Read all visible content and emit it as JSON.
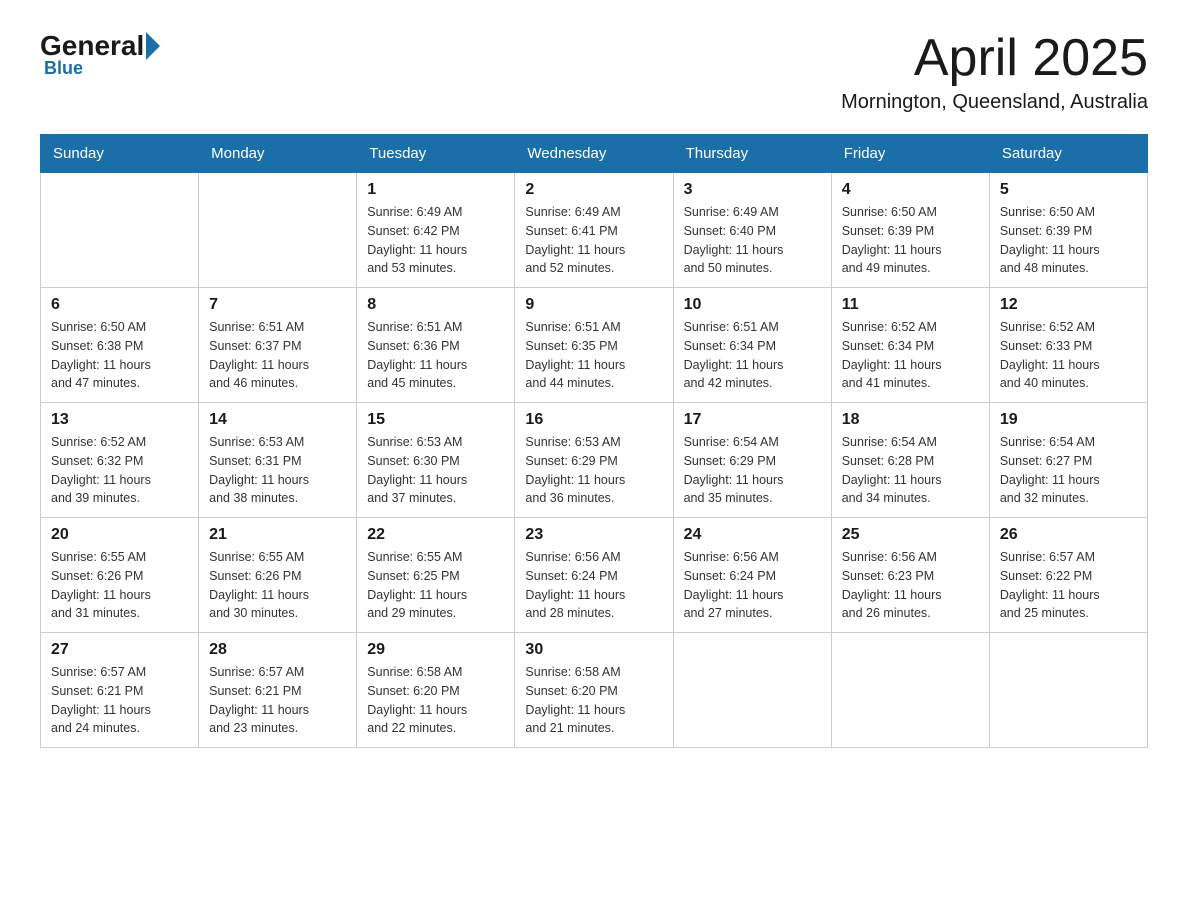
{
  "header": {
    "logo_general": "General",
    "logo_blue": "Blue",
    "month_title": "April 2025",
    "location": "Mornington, Queensland, Australia"
  },
  "weekdays": [
    "Sunday",
    "Monday",
    "Tuesday",
    "Wednesday",
    "Thursday",
    "Friday",
    "Saturday"
  ],
  "weeks": [
    [
      {
        "day": "",
        "info": ""
      },
      {
        "day": "",
        "info": ""
      },
      {
        "day": "1",
        "info": "Sunrise: 6:49 AM\nSunset: 6:42 PM\nDaylight: 11 hours\nand 53 minutes."
      },
      {
        "day": "2",
        "info": "Sunrise: 6:49 AM\nSunset: 6:41 PM\nDaylight: 11 hours\nand 52 minutes."
      },
      {
        "day": "3",
        "info": "Sunrise: 6:49 AM\nSunset: 6:40 PM\nDaylight: 11 hours\nand 50 minutes."
      },
      {
        "day": "4",
        "info": "Sunrise: 6:50 AM\nSunset: 6:39 PM\nDaylight: 11 hours\nand 49 minutes."
      },
      {
        "day": "5",
        "info": "Sunrise: 6:50 AM\nSunset: 6:39 PM\nDaylight: 11 hours\nand 48 minutes."
      }
    ],
    [
      {
        "day": "6",
        "info": "Sunrise: 6:50 AM\nSunset: 6:38 PM\nDaylight: 11 hours\nand 47 minutes."
      },
      {
        "day": "7",
        "info": "Sunrise: 6:51 AM\nSunset: 6:37 PM\nDaylight: 11 hours\nand 46 minutes."
      },
      {
        "day": "8",
        "info": "Sunrise: 6:51 AM\nSunset: 6:36 PM\nDaylight: 11 hours\nand 45 minutes."
      },
      {
        "day": "9",
        "info": "Sunrise: 6:51 AM\nSunset: 6:35 PM\nDaylight: 11 hours\nand 44 minutes."
      },
      {
        "day": "10",
        "info": "Sunrise: 6:51 AM\nSunset: 6:34 PM\nDaylight: 11 hours\nand 42 minutes."
      },
      {
        "day": "11",
        "info": "Sunrise: 6:52 AM\nSunset: 6:34 PM\nDaylight: 11 hours\nand 41 minutes."
      },
      {
        "day": "12",
        "info": "Sunrise: 6:52 AM\nSunset: 6:33 PM\nDaylight: 11 hours\nand 40 minutes."
      }
    ],
    [
      {
        "day": "13",
        "info": "Sunrise: 6:52 AM\nSunset: 6:32 PM\nDaylight: 11 hours\nand 39 minutes."
      },
      {
        "day": "14",
        "info": "Sunrise: 6:53 AM\nSunset: 6:31 PM\nDaylight: 11 hours\nand 38 minutes."
      },
      {
        "day": "15",
        "info": "Sunrise: 6:53 AM\nSunset: 6:30 PM\nDaylight: 11 hours\nand 37 minutes."
      },
      {
        "day": "16",
        "info": "Sunrise: 6:53 AM\nSunset: 6:29 PM\nDaylight: 11 hours\nand 36 minutes."
      },
      {
        "day": "17",
        "info": "Sunrise: 6:54 AM\nSunset: 6:29 PM\nDaylight: 11 hours\nand 35 minutes."
      },
      {
        "day": "18",
        "info": "Sunrise: 6:54 AM\nSunset: 6:28 PM\nDaylight: 11 hours\nand 34 minutes."
      },
      {
        "day": "19",
        "info": "Sunrise: 6:54 AM\nSunset: 6:27 PM\nDaylight: 11 hours\nand 32 minutes."
      }
    ],
    [
      {
        "day": "20",
        "info": "Sunrise: 6:55 AM\nSunset: 6:26 PM\nDaylight: 11 hours\nand 31 minutes."
      },
      {
        "day": "21",
        "info": "Sunrise: 6:55 AM\nSunset: 6:26 PM\nDaylight: 11 hours\nand 30 minutes."
      },
      {
        "day": "22",
        "info": "Sunrise: 6:55 AM\nSunset: 6:25 PM\nDaylight: 11 hours\nand 29 minutes."
      },
      {
        "day": "23",
        "info": "Sunrise: 6:56 AM\nSunset: 6:24 PM\nDaylight: 11 hours\nand 28 minutes."
      },
      {
        "day": "24",
        "info": "Sunrise: 6:56 AM\nSunset: 6:24 PM\nDaylight: 11 hours\nand 27 minutes."
      },
      {
        "day": "25",
        "info": "Sunrise: 6:56 AM\nSunset: 6:23 PM\nDaylight: 11 hours\nand 26 minutes."
      },
      {
        "day": "26",
        "info": "Sunrise: 6:57 AM\nSunset: 6:22 PM\nDaylight: 11 hours\nand 25 minutes."
      }
    ],
    [
      {
        "day": "27",
        "info": "Sunrise: 6:57 AM\nSunset: 6:21 PM\nDaylight: 11 hours\nand 24 minutes."
      },
      {
        "day": "28",
        "info": "Sunrise: 6:57 AM\nSunset: 6:21 PM\nDaylight: 11 hours\nand 23 minutes."
      },
      {
        "day": "29",
        "info": "Sunrise: 6:58 AM\nSunset: 6:20 PM\nDaylight: 11 hours\nand 22 minutes."
      },
      {
        "day": "30",
        "info": "Sunrise: 6:58 AM\nSunset: 6:20 PM\nDaylight: 11 hours\nand 21 minutes."
      },
      {
        "day": "",
        "info": ""
      },
      {
        "day": "",
        "info": ""
      },
      {
        "day": "",
        "info": ""
      }
    ]
  ]
}
